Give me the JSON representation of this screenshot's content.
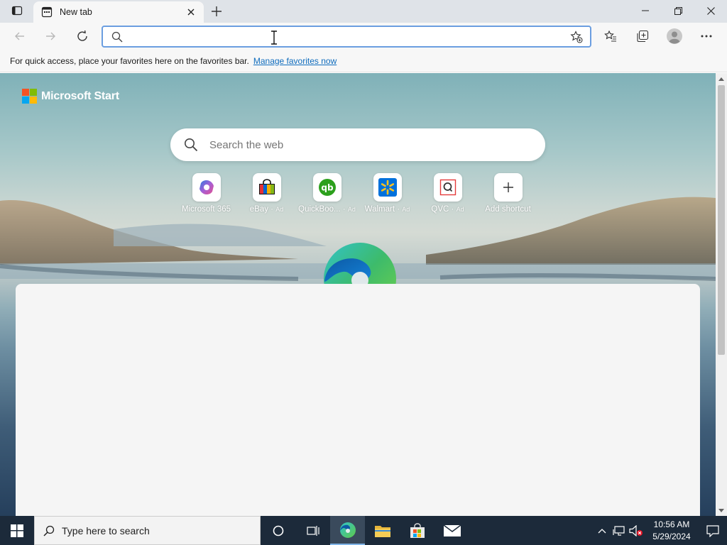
{
  "browser": {
    "tab": {
      "title": "New tab",
      "favicon": "new-tab-page-icon",
      "close_icon": "close-icon"
    },
    "new_tab_icon": "plus-icon",
    "window_controls": [
      "minimize-icon",
      "restore-icon",
      "close-icon"
    ]
  },
  "toolbar": {
    "back_icon": "back-arrow-icon",
    "forward_icon": "forward-arrow-icon",
    "refresh_icon": "refresh-icon",
    "address": {
      "value": "",
      "placeholder": ""
    },
    "add_favorite_icon": "star-plus-icon",
    "favorites_icon": "favorites-icon",
    "collections_icon": "collections-icon",
    "profile_icon": "profile-avatar-icon",
    "menu_icon": "more-icon"
  },
  "favorites_bar": {
    "message": "For quick access, place your favorites here on the favorites bar.",
    "link": "Manage favorites now"
  },
  "new_tab_page": {
    "brand": "Microsoft Start",
    "search": {
      "placeholder": "Search the web"
    },
    "shortcuts": [
      {
        "label": "Microsoft 365",
        "ad": "",
        "icon": "microsoft365-icon"
      },
      {
        "label": "eBay",
        "ad": "Ad",
        "icon": "ebay-icon"
      },
      {
        "label": "QuickBoo...",
        "ad": "Ad",
        "icon": "quickbooks-icon"
      },
      {
        "label": "Walmart",
        "ad": "Ad",
        "icon": "walmart-icon"
      },
      {
        "label": "QVC",
        "ad": "Ad",
        "icon": "qvc-icon"
      },
      {
        "label": "Add shortcut",
        "ad": "",
        "icon": "plus-icon"
      }
    ]
  },
  "taskbar": {
    "search_placeholder": "Type here to search",
    "time": "10:56 AM",
    "date": "5/29/2024"
  },
  "colors": {
    "accent": "#0f6cbd",
    "address_border": "#6b9ee0",
    "taskbar": "#1c2a3a"
  }
}
